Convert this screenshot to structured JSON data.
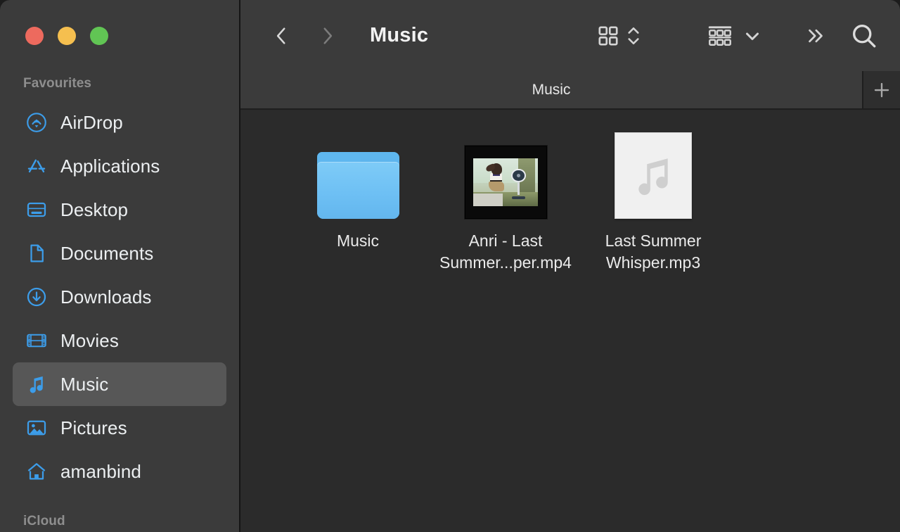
{
  "window": {
    "traffic_lights": [
      {
        "name": "close",
        "color": "#ED6A5E"
      },
      {
        "name": "minimize",
        "color": "#F5BF4F"
      },
      {
        "name": "maximize",
        "color": "#61C554"
      }
    ]
  },
  "sidebar": {
    "sections": [
      {
        "label": "Favourites"
      },
      {
        "label": "iCloud"
      }
    ],
    "items": [
      {
        "label": "AirDrop",
        "icon": "airdrop-icon",
        "selected": false
      },
      {
        "label": "Applications",
        "icon": "applications-icon",
        "selected": false
      },
      {
        "label": "Desktop",
        "icon": "desktop-icon",
        "selected": false
      },
      {
        "label": "Documents",
        "icon": "documents-icon",
        "selected": false
      },
      {
        "label": "Downloads",
        "icon": "downloads-icon",
        "selected": false
      },
      {
        "label": "Movies",
        "icon": "movies-icon",
        "selected": false
      },
      {
        "label": "Music",
        "icon": "music-icon",
        "selected": true
      },
      {
        "label": "Pictures",
        "icon": "pictures-icon",
        "selected": false
      },
      {
        "label": "amanbind",
        "icon": "home-icon",
        "selected": false
      }
    ]
  },
  "toolbar": {
    "back_icon": "chevron-left-icon",
    "forward_icon": "chevron-right-icon",
    "title": "Music",
    "view_icon": "icon-view-grid-icon",
    "view_chevron_icon": "chevron-up-down-icon",
    "group_icon": "group-by-icon",
    "group_chevron_icon": "chevron-down-icon",
    "overflow_icon": "double-chevron-right-icon",
    "search_icon": "search-icon"
  },
  "tabbar": {
    "tabs": [
      {
        "label": "Music",
        "active": true
      }
    ],
    "new_tab_label": "+"
  },
  "files": [
    {
      "name": "Music",
      "kind": "folder"
    },
    {
      "name": "Anri - Last Summer...per.mp4",
      "kind": "video"
    },
    {
      "name": "Last Summer Whisper.mp3",
      "kind": "audio"
    }
  ],
  "colors": {
    "sidebar_bg": "#3b3b3b",
    "content_bg": "#2b2b2b",
    "accent_blue": "#3c9dea",
    "selected_bg": "#575757",
    "text_primary": "#eceff1",
    "text_muted": "#8e8e8e"
  }
}
